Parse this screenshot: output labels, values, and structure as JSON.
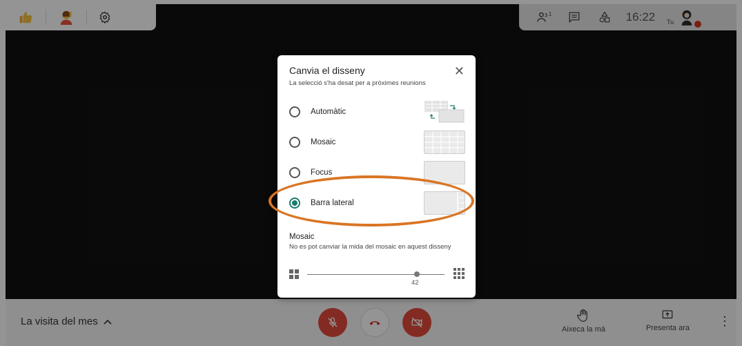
{
  "top_left_toolbar": {
    "items": [
      {
        "icon": "thumbs-up-icon"
      },
      {
        "icon": "person-raising-hand-icon"
      },
      {
        "icon": "gear-icon"
      }
    ]
  },
  "top_right_toolbar": {
    "clock": "16:22",
    "self_label": "Tu",
    "participants_count": "1"
  },
  "bottom_bar": {
    "meeting_title": "La visita del mes",
    "raise_hand_label": "Aixeca la mà",
    "present_label": "Presenta ara"
  },
  "dialog": {
    "title": "Canvia el disseny",
    "subtitle": "La selecció s'ha desat per a pròximes reunions",
    "options": [
      {
        "label": "Automàtic",
        "selected": false
      },
      {
        "label": "Mosaic",
        "selected": false
      },
      {
        "label": "Focus",
        "selected": false
      },
      {
        "label": "Barra lateral",
        "selected": true
      }
    ],
    "tile_section": {
      "title": "Mosaic",
      "description": "No es pot canviar la mida del mosaic en aquest disseny",
      "slider_value": "42"
    }
  },
  "colors": {
    "accent": "#1a7a6b",
    "highlight_ellipse": "#d97524",
    "end_call_red": "#e24b3c"
  }
}
